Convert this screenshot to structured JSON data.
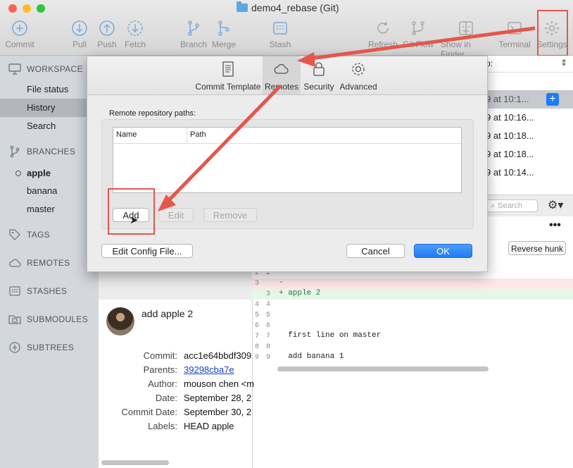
{
  "window": {
    "title": "demo4_rebase (Git)"
  },
  "toolbar": {
    "commit": "Commit",
    "pull": "Pull",
    "push": "Push",
    "fetch": "Fetch",
    "branch": "Branch",
    "merge": "Merge",
    "stash": "Stash",
    "refresh": "Refresh",
    "git_flow": "Git Flow",
    "show_in_finder": "Show in Finder",
    "terminal": "Terminal",
    "settings": "Settings"
  },
  "sidebar": {
    "workspace": "WORKSPACE",
    "workspace_items": [
      "File status",
      "History",
      "Search"
    ],
    "branches": "BRANCHES",
    "branch_items": [
      "apple",
      "banana",
      "master"
    ],
    "tags": "TAGS",
    "remotes": "REMOTES",
    "stashes": "STASHES",
    "submodules": "SUBMODULES",
    "subtrees": "SUBTREES"
  },
  "right_list": {
    "header_fragment": "o:",
    "rows": [
      "9 at 10:1...",
      "9 at 10:16...",
      "9 at 10:18...",
      "9 at 10:18...",
      "9 at 10:14..."
    ],
    "search_placeholder": "Search",
    "reverse_hunk": "Reverse hunk"
  },
  "dialog": {
    "tabs": [
      "Commit Template",
      "Remotes",
      "Security",
      "Advanced"
    ],
    "selected_tab": "Remotes",
    "section_label": "Remote repository paths:",
    "col_name": "Name",
    "col_path": "Path",
    "add": "Add",
    "edit": "Edit",
    "remove": "Remove",
    "edit_config": "Edit Config File...",
    "cancel": "Cancel",
    "ok": "OK"
  },
  "commit": {
    "message": "add apple 2",
    "labels": {
      "commit": "Commit:",
      "parents": "Parents:",
      "author": "Author:",
      "date": "Date:",
      "commit_date": "Commit Date:",
      "labels": "Labels:"
    },
    "values": {
      "commit": "acc1e64bbdf309",
      "parents": "39298cba7e",
      "author": "mouson chen <m",
      "date": "September 28, 2",
      "commit_date": "September 30, 2",
      "labels": "HEAD apple"
    }
  },
  "diff": {
    "lines": [
      {
        "old": "2",
        "new": "2",
        "text": ""
      },
      {
        "old": "3",
        "new": "",
        "text": "-"
      },
      {
        "old": "",
        "new": "3",
        "text": "+ apple 2"
      },
      {
        "old": "4",
        "new": "4",
        "text": ""
      },
      {
        "old": "5",
        "new": "5",
        "text": ""
      },
      {
        "old": "6",
        "new": "6",
        "text": ""
      },
      {
        "old": "7",
        "new": "7",
        "text": "  first line on master"
      },
      {
        "old": "8",
        "new": "8",
        "text": ""
      },
      {
        "old": "9",
        "new": "9",
        "text": "  add banana 1"
      }
    ]
  },
  "colors": {
    "accent": "#1f7bf2",
    "annotation": "#e5564b"
  }
}
